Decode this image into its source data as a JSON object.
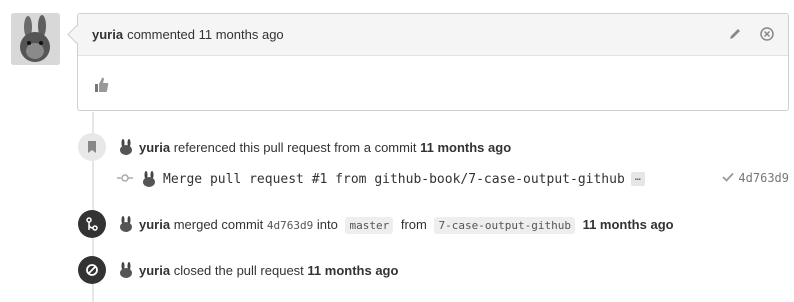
{
  "comment": {
    "author": "yuria",
    "action_text": "commented 11 months ago",
    "body_icon": "thumbs-up-icon"
  },
  "events": {
    "referenced": {
      "author": "yuria",
      "text_before": "referenced this pull request from a commit",
      "time": "11 months ago"
    },
    "commit": {
      "message": "Merge pull request #1 from github-book/7-case-output-github",
      "ellipsis": "…",
      "sha": "4d763d9"
    },
    "merged": {
      "author": "yuria",
      "text1": "merged commit",
      "sha": "4d763d9",
      "text2": "into",
      "base": "master",
      "text3": "from",
      "head": "7-case-output-github",
      "time": "11 months ago"
    },
    "closed": {
      "author": "yuria",
      "text": "closed the pull request",
      "time": "11 months ago"
    }
  },
  "icons": {
    "edit": "pencil-icon",
    "delete": "close-circle-icon",
    "bookmark": "bookmark-icon",
    "merge": "merge-icon",
    "closed": "circle-slash-icon",
    "commit": "git-commit-icon",
    "check": "check-icon"
  },
  "colors": {
    "timeline_badge_dark": "#333333",
    "timeline_badge_light": "#e8e8e8",
    "comment_header_bg": "#f5f5f5"
  }
}
